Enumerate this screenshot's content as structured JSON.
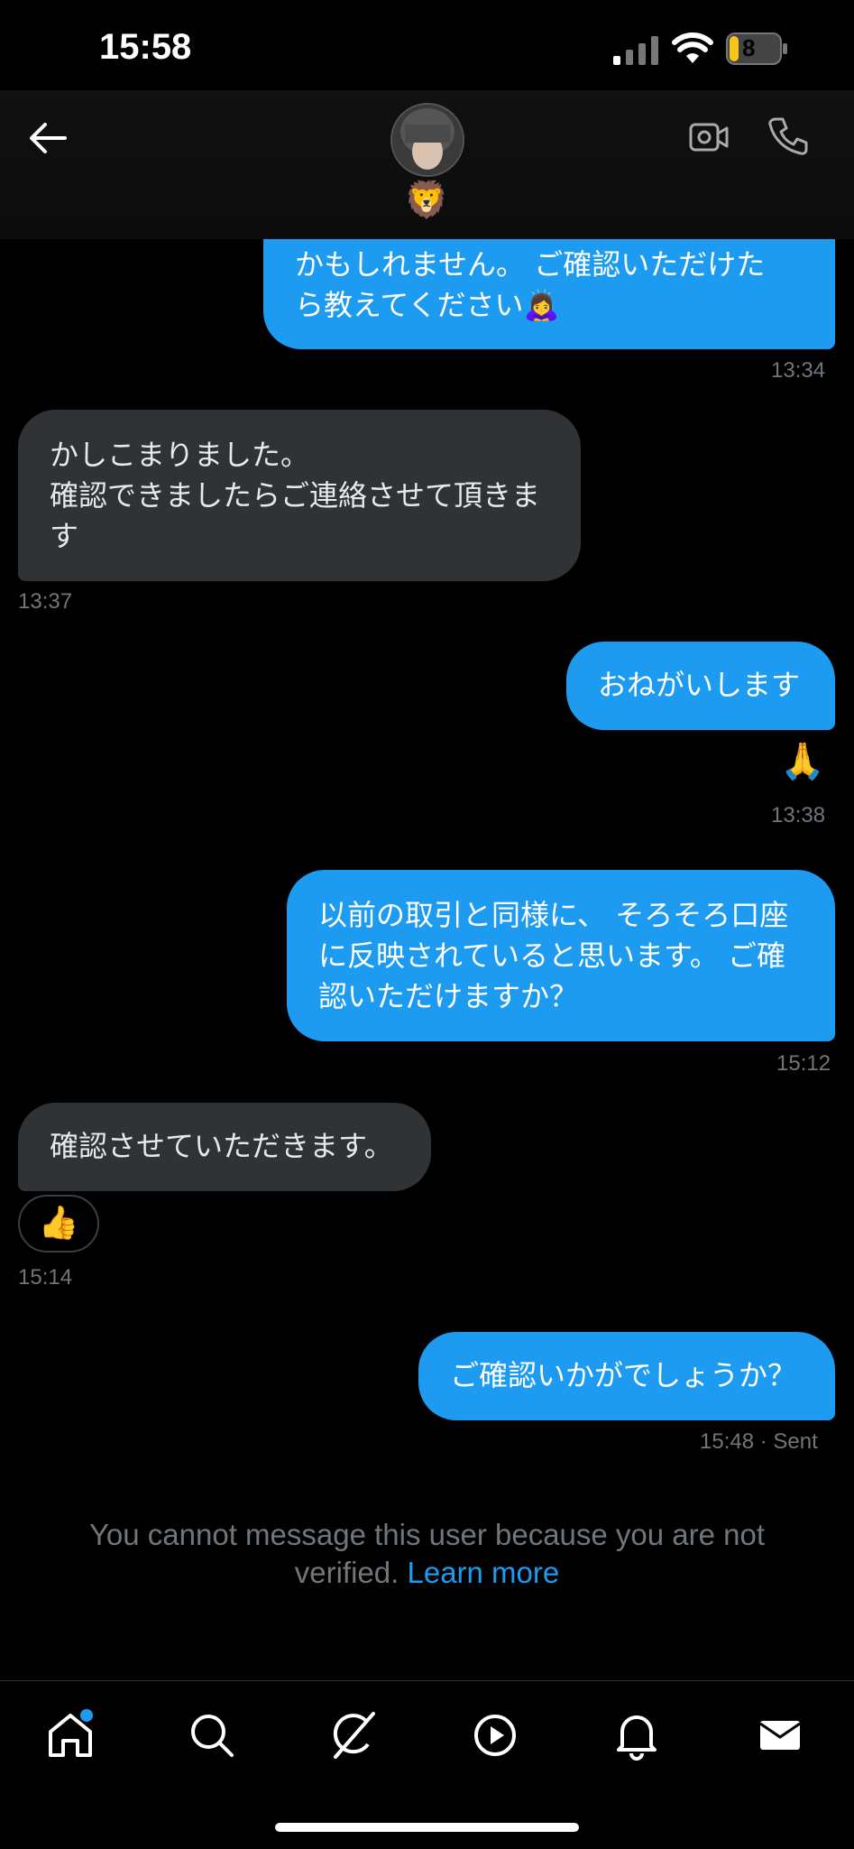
{
  "status": {
    "time": "15:58",
    "battery": "8"
  },
  "header": {
    "contact_emoji": "🦁"
  },
  "messages": [
    {
      "lines": [
        "かもしれません。 ご確認いただけた",
        "ら教えてください🙇‍♀️"
      ],
      "time": "13:34"
    },
    {
      "lines": [
        "かしこまりました。",
        "確認できましたらご連絡させて頂きま",
        "す"
      ],
      "time": "13:37"
    },
    {
      "lines": [
        "おねがいします"
      ],
      "time": "13:38",
      "reaction": "🙏"
    },
    {
      "lines": [
        "以前の取引と同様に、 そろそろ口座",
        "に反映されていると思います。 ご確",
        "認いただけますか？"
      ],
      "time": "15:12"
    },
    {
      "lines": [
        "確認させていただきます。"
      ],
      "time": "15:14",
      "reaction": "👍"
    },
    {
      "lines": [
        "ご確認いかがでしょうか？"
      ],
      "time": "15:48",
      "status": "· Sent"
    }
  ],
  "notice": {
    "text": "You cannot message this user because you are not verified.",
    "link": "Learn more"
  },
  "tabs": [
    "home-icon",
    "search-icon",
    "grok-icon",
    "video-icon",
    "notifications-icon",
    "messages-icon"
  ]
}
